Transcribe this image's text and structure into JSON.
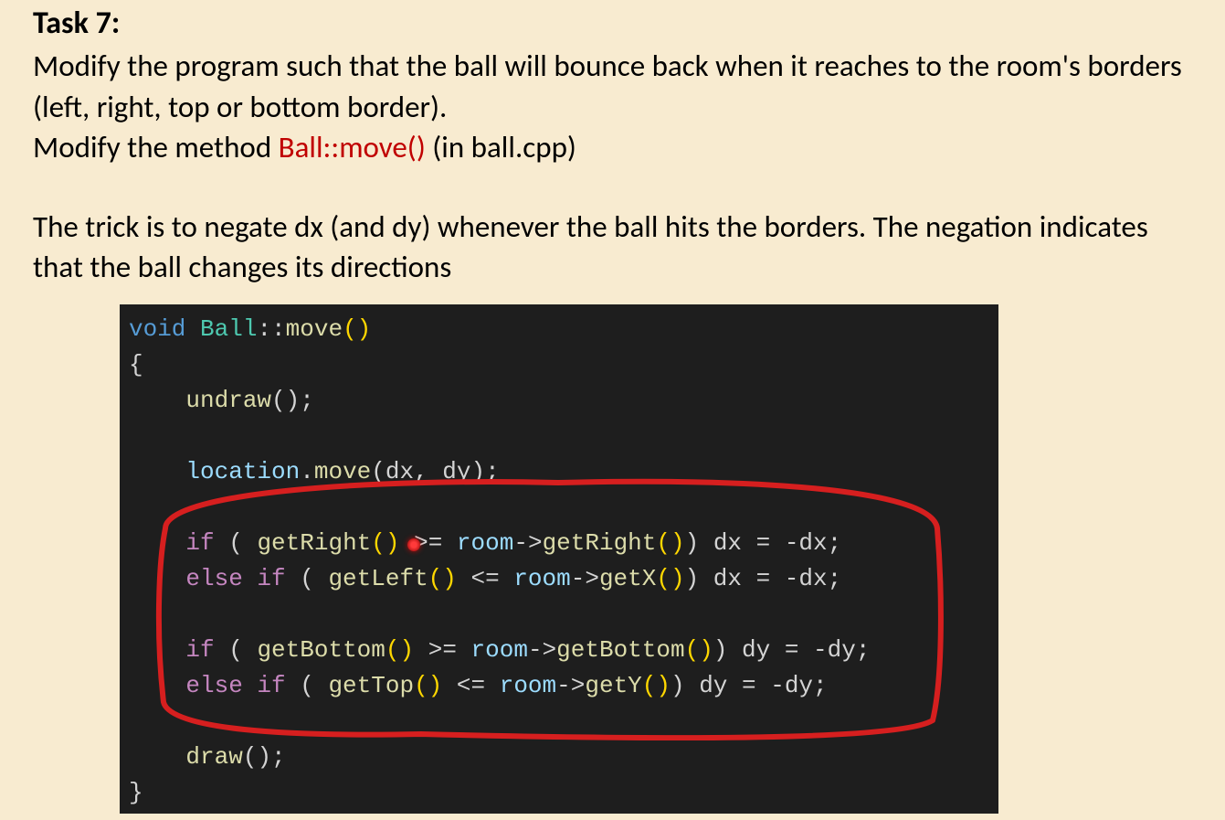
{
  "task": {
    "title": "Task 7:",
    "desc_line1": "Modify the program such that the ball will bounce back when it reaches to the room's borders (left, right, top or bottom border).",
    "desc_line2_prefix": "Modify the method ",
    "desc_line2_ref": "Ball::move()",
    "desc_line2_suffix": " (in ball.cpp)",
    "trick": "The trick is to negate dx (and dy) whenever the ball hits the borders. The negation indicates that the ball changes its directions"
  },
  "code": {
    "l1_void": "void",
    "l1_cls": " Ball",
    "l1_scope": "::",
    "l1_fn": "move",
    "l1_par": "()",
    "l2": "{",
    "l3_indent": "    ",
    "l3_fn": "undraw",
    "l3_rest": "();",
    "l4_indent": "    ",
    "l4_var": "location",
    "l4_dot": ".",
    "l4_fn": "move",
    "l4_args": "(dx, dy);",
    "l5_indent": "    ",
    "l5_if": "if",
    "l5_sp": " ( ",
    "l5_fn1": "getRight",
    "l5_par1": "()",
    "l5_op": " >= ",
    "l5_room": "room",
    "l5_arrow": "->",
    "l5_fn2": "getRight",
    "l5_par2": "()",
    "l5_close": ") dx = -dx;",
    "l6_indent": "    ",
    "l6_else": "else if",
    "l6_sp": " ( ",
    "l6_fn1": "getLeft",
    "l6_par1": "()",
    "l6_op": " <= ",
    "l6_room": "room",
    "l6_arrow": "->",
    "l6_fn2": "getX",
    "l6_par2": "()",
    "l6_close": ") dx = -dx;",
    "l7_indent": "    ",
    "l7_if": "if",
    "l7_sp": " ( ",
    "l7_fn1": "getBottom",
    "l7_par1": "()",
    "l7_op": " >= ",
    "l7_room": "room",
    "l7_arrow": "->",
    "l7_fn2": "getBottom",
    "l7_par2": "()",
    "l7_close": ") dy = -dy;",
    "l8_indent": "    ",
    "l8_else": "else if",
    "l8_sp": " ( ",
    "l8_fn1": "getTop",
    "l8_par1": "()",
    "l8_op": " <= ",
    "l8_room": "room",
    "l8_arrow": "->",
    "l8_fn2": "getY",
    "l8_par2": "()",
    "l8_close": ") dy = -dy;",
    "l9_indent": "    ",
    "l9_fn": "draw",
    "l9_rest": "();",
    "l10": "}"
  }
}
